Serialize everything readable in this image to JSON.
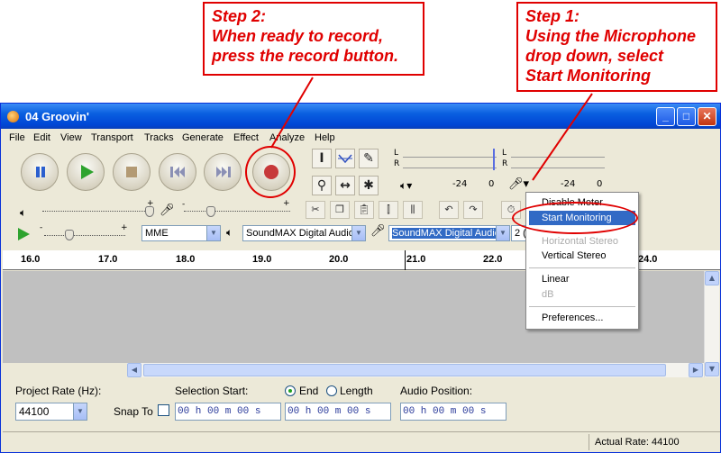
{
  "callouts": {
    "step2": [
      "Step 2:",
      "When ready to record,",
      "press the record button."
    ],
    "step1": [
      "Step 1:",
      "Using the Microphone",
      "drop down, select",
      "Start Monitoring"
    ]
  },
  "window": {
    "title": "04 Groovin'",
    "controls": [
      "minimize",
      "maximize",
      "close"
    ]
  },
  "menubar": [
    "File",
    "Edit",
    "View",
    "Transport",
    "Tracks",
    "Generate",
    "Effect",
    "Analyze",
    "Help"
  ],
  "meters": {
    "l": "L",
    "r": "R",
    "play_scale": [
      "-24",
      "0"
    ],
    "rec_scale": [
      "-24",
      "0"
    ]
  },
  "slider": {
    "plus": "+",
    "minus": "-"
  },
  "devices": {
    "host": "MME",
    "playback": "SoundMAX Digital Audio",
    "recording": "SoundMAX Digital Audio",
    "channels": "2 ("
  },
  "ruler": [
    "16.0",
    "17.0",
    "18.0",
    "19.0",
    "20.0",
    "21.0",
    "22.0",
    "24.0"
  ],
  "mic_menu": {
    "items": [
      "Disable Meter",
      "Start Monitoring",
      "Horizontal Stereo",
      "Vertical Stereo",
      "Linear",
      "dB",
      "Preferences..."
    ],
    "highlighted": "Start Monitoring"
  },
  "selection_bar": {
    "project_rate_label": "Project Rate (Hz):",
    "project_rate_value": "44100",
    "snap_to_label": "Snap To",
    "selection_start_label": "Selection Start:",
    "end_label": "End",
    "length_label": "Length",
    "audio_position_label": "Audio Position:",
    "time_start": "00 h 00 m 00 s",
    "time_end": "00 h 00 m 00 s",
    "time_pos": "00 h 00 m 00 s"
  },
  "status": {
    "actual_rate": "Actual Rate: 44100"
  },
  "colors": {
    "callout_red": "#e00000",
    "title_blue": "#0a5fe0",
    "menu_highlight": "#316ac5"
  }
}
